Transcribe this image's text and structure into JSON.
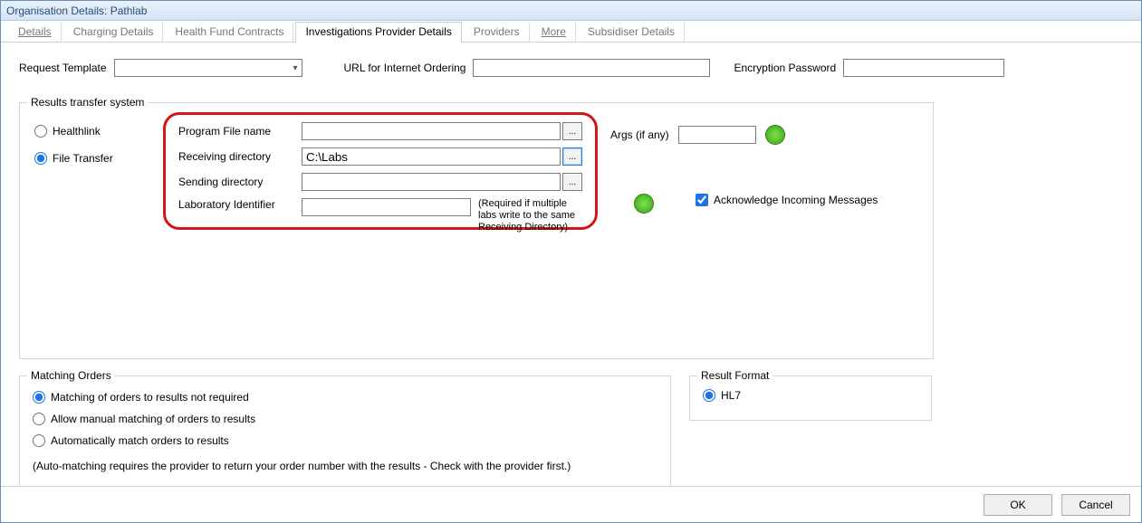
{
  "window": {
    "title": "Organisation Details: Pathlab"
  },
  "tabs": {
    "details": "Details",
    "charging": "Charging Details",
    "health_fund": "Health Fund Contracts",
    "investigations": "Investigations Provider Details",
    "providers": "Providers",
    "more": "More",
    "subsidiser": "Subsidiser Details"
  },
  "top": {
    "request_template_label": "Request Template",
    "request_template_value": "",
    "url_label": "URL for Internet Ordering",
    "url_value": "",
    "enc_label": "Encryption Password",
    "enc_value": ""
  },
  "results": {
    "legend": "Results transfer system",
    "healthlink_label": "Healthlink",
    "filetransfer_label": "File Transfer",
    "prog_label": "Program File name",
    "prog_value": "",
    "recv_label": "Receiving directory",
    "recv_value": "C:\\Labs",
    "send_label": "Sending directory",
    "send_value": "",
    "lab_label": "Laboratory Identifier",
    "lab_value": "",
    "lab_note": "(Required if multiple labs write to the same Receiving Directory)",
    "browse": "...",
    "args_label": "Args (if any)",
    "args_value": "",
    "ack_label": "Acknowledge Incoming Messages"
  },
  "matching": {
    "legend": "Matching Orders",
    "opt1": "Matching of orders to results not required",
    "opt2": "Allow manual matching of orders to results",
    "opt3": "Automatically match orders to results",
    "note": "(Auto-matching requires the provider to return your order number with the results - Check with the provider first.)"
  },
  "result_format": {
    "legend": "Result Format",
    "hl7": "HL7"
  },
  "footer": {
    "ok": "OK",
    "cancel": "Cancel"
  }
}
